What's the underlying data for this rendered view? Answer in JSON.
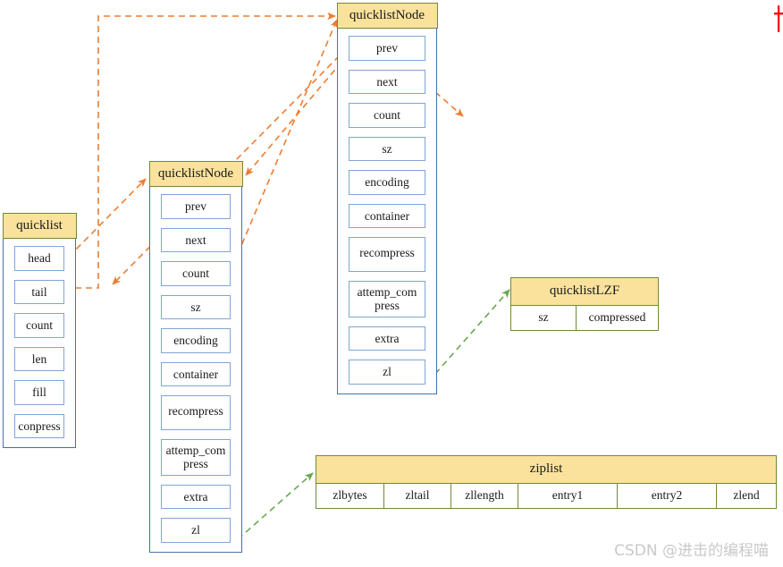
{
  "diagram": {
    "title": "Redis quicklist structure diagram",
    "colors": {
      "header_fill": "#fae29c",
      "header_border": "#6f8c33",
      "struct_border": "#4472a8",
      "field_border": "#7fa6d4",
      "orange_arrow": "#ed7d31",
      "green_arrow": "#6aa84f",
      "watermark": "#c9c9c9",
      "red_mark": "#ff0000"
    },
    "blocks": {
      "quicklist": {
        "title": "quicklist",
        "fields": [
          "head",
          "tail",
          "count",
          "len",
          "fill",
          "conpress"
        ]
      },
      "quicklist_node_1": {
        "title": "quicklistNode",
        "fields": [
          "prev",
          "next",
          "count",
          "sz",
          "encoding",
          "container",
          "recompress",
          "attemp_compress",
          "extra",
          "zl"
        ],
        "attemp_line1": "attemp_com",
        "attemp_line2": "press"
      },
      "quicklist_node_2": {
        "title": "quicklistNode",
        "fields": [
          "prev",
          "next",
          "count",
          "sz",
          "encoding",
          "container",
          "recompress",
          "attemp_compress",
          "extra",
          "zl"
        ],
        "attemp_line1": "attemp_com",
        "attemp_line2": "press"
      },
      "quicklist_lzf": {
        "title": "quicklistLZF",
        "cells": [
          "sz",
          "compressed"
        ]
      },
      "ziplist": {
        "title": "ziplist",
        "cells": [
          "zlbytes",
          "zltail",
          "zllength",
          "entry1",
          "entry2",
          "zlend"
        ]
      }
    },
    "arrows": [
      {
        "name": "tail-to-node2-top",
        "style": "orange-dashed-orthogonal",
        "from": "quicklist.tail",
        "to": "quicklist_node_2.title"
      },
      {
        "name": "tail-to-node1-title",
        "style": "orange-dashed",
        "from": "quicklist.tail",
        "to": "quicklist_node_1.title"
      },
      {
        "name": "head-to-node1-title",
        "style": "orange-dashed",
        "from": "quicklist.head",
        "to": "quicklist_node_1.title"
      },
      {
        "name": "node1-next-to-node2-title",
        "style": "orange-dashed",
        "from": "quicklist_node_1.next",
        "to": "quicklist_node_2.title"
      },
      {
        "name": "node2-prev-to-node1-next",
        "style": "orange-dashed",
        "from": "quicklist_node_2.prev",
        "to": "quicklist_node_1.next"
      },
      {
        "name": "node2-next-outgoing",
        "style": "orange-dashed",
        "from": "quicklist_node_2.next",
        "to": "off-diagram"
      },
      {
        "name": "node2-zl-to-quicklistlzf",
        "style": "green-dashed",
        "from": "quicklist_node_2.zl",
        "to": "quicklist_lzf.title"
      },
      {
        "name": "node1-zl-to-ziplist",
        "style": "green-dashed",
        "from": "quicklist_node_1.zl",
        "to": "ziplist.title"
      }
    ]
  },
  "watermark": {
    "text": "CSDN @进击的编程喵"
  }
}
